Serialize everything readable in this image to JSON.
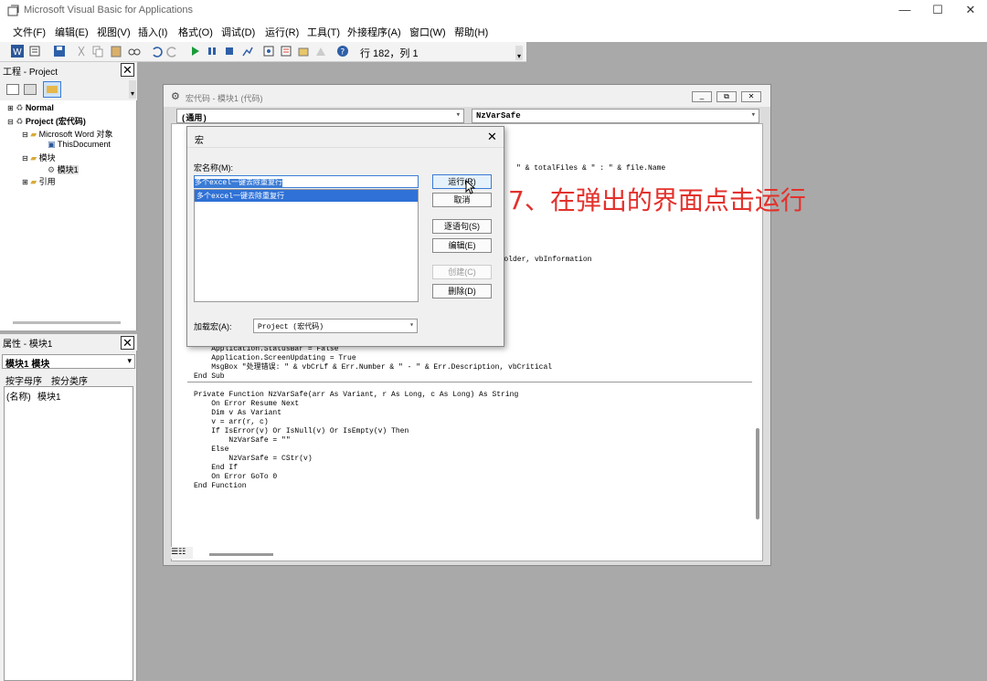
{
  "app": {
    "title": "Microsoft Visual Basic for Applications"
  },
  "window_controls": {
    "minimize": "—",
    "maximize": "☐",
    "close": "✕"
  },
  "menu": [
    "文件(F)",
    "编辑(E)",
    "视图(V)",
    "插入(I)",
    "格式(O)",
    "调试(D)",
    "运行(R)",
    "工具(T)",
    "外接程序(A)",
    "窗口(W)",
    "帮助(H)"
  ],
  "toolbar": {
    "status": "行 182，列 1"
  },
  "project": {
    "title": "工程 - Project",
    "tree": [
      "Normal",
      "Project (宏代码)",
      "Microsoft Word 对象",
      "ThisDocument",
      "模块",
      "模块1",
      "引用"
    ]
  },
  "properties": {
    "title": "属性 - 模块1",
    "selector": "模块1 模块",
    "tabs": [
      "按字母序",
      "按分类序"
    ],
    "row_name": "(名称)",
    "row_value": "模块1"
  },
  "code_window": {
    "title": "宏代码 - 模块1 (代码)",
    "object_combo": "(通用)",
    "proc_combo": "NzVarSafe",
    "lines_top": [
      "\" & totalFiles & \" : \" & file.Name",
      "utFolder, vbInformation"
    ],
    "lines_bottom": [
      "    Application.StatusBar = False",
      "    Application.ScreenUpdating = True",
      "    MsgBox \"处理错误: \" & vbCrLf & Err.Number & \" - \" & Err.Description, vbCritical",
      "End Sub",
      "",
      "Private Function NzVarSafe(arr As Variant, r As Long, c As Long) As String",
      "    On Error Resume Next",
      "    Dim v As Variant",
      "    v = arr(r, c)",
      "    If IsError(v) Or IsNull(v) Or IsEmpty(v) Then",
      "        NzVarSafe = \"\"",
      "    Else",
      "        NzVarSafe = CStr(v)",
      "    End If",
      "    On Error GoTo 0",
      "End Function"
    ]
  },
  "macro_dialog": {
    "title": "宏",
    "name_label": "宏名称(M):",
    "name_value": "多个excel一键去除重复行",
    "list": [
      "多个excel一键去除重复行"
    ],
    "buttons": {
      "run": "运行(R)",
      "cancel": "取消",
      "step": "逐语句(S)",
      "edit": "编辑(E)",
      "create": "创建(C)",
      "delete": "删除(D)"
    },
    "location_label": "加载宏(A):",
    "location_value": "Project (宏代码)"
  },
  "annotation": "7、在弹出的界面点击运行"
}
